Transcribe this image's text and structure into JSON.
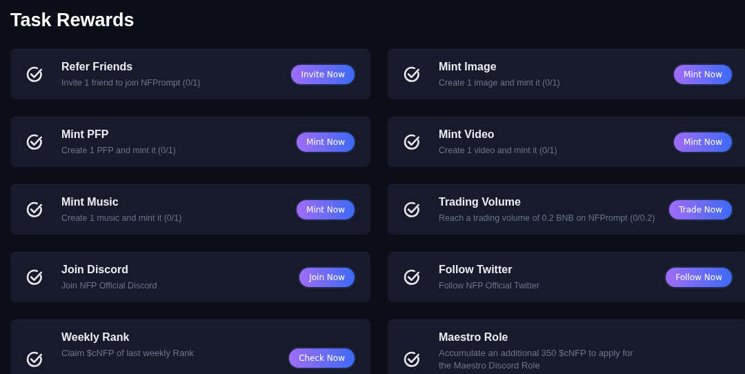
{
  "title": "Task Rewards",
  "tasks": [
    {
      "name": "Refer Friends",
      "description": "Invite 1 friend to join NFPrompt (0/1)",
      "action": "Invite Now"
    },
    {
      "name": "Mint Image",
      "description": "Create 1 image and mint it (0/1)",
      "action": "Mint Now"
    },
    {
      "name": "Mint PFP",
      "description": "Create 1 PFP and mint it (0/1)",
      "action": "Mint Now"
    },
    {
      "name": "Mint Video",
      "description": "Create 1 video and mint it (0/1)",
      "action": "Mint Now"
    },
    {
      "name": "Mint Music",
      "description": "Create 1 music and mint it (0/1)",
      "action": "Mint Now"
    },
    {
      "name": "Trading Volume",
      "description": "Reach a trading volume of 0.2 BNB on NFPrompt (0/0.2)",
      "action": "Trade Now"
    },
    {
      "name": "Join Discord",
      "description": "Join NFP Official Discord",
      "action": "Join Now"
    },
    {
      "name": "Follow Twitter",
      "description": "Follow NFP Official Twitter",
      "action": "Follow Now"
    },
    {
      "name": "Weekly Rank",
      "description": "Claim $cNFP of last weekly Rank",
      "action": "Check Now"
    },
    {
      "name": "Maestro Role",
      "description": "Accumulate an additional 350 $cNFP to apply for the Maestro Discord Role"
    }
  ]
}
